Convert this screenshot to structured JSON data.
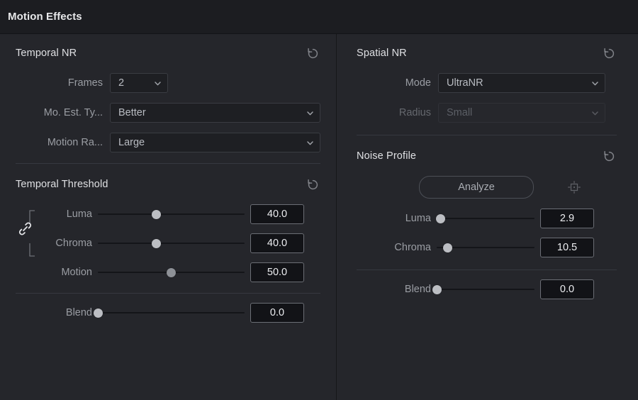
{
  "window": {
    "title": "Motion Effects"
  },
  "colors": {
    "background": "#25262b",
    "titlebar": "#1c1d21",
    "text_primary": "#dfe0e3",
    "text_label": "#9a9da3",
    "text_disabled": "#5c5f66",
    "value_text": "#ecedf0",
    "knob": "#bcbec3",
    "track": "#141519",
    "separator": "#363840"
  },
  "left_panel": {
    "temporal_nr": {
      "title": "Temporal NR",
      "reset_icon": "reset-icon",
      "fields": [
        {
          "label": "Frames",
          "value": "2",
          "type": "dropdown",
          "size": "small",
          "disabled": false
        },
        {
          "label": "Mo. Est. Ty...",
          "value": "Better",
          "type": "dropdown",
          "size": "large",
          "disabled": false
        },
        {
          "label": "Motion Ra...",
          "value": "Large",
          "type": "dropdown",
          "size": "large",
          "disabled": false
        }
      ]
    },
    "temporal_threshold": {
      "title": "Temporal Threshold",
      "reset_icon": "reset-icon",
      "link_icon": "link-icon",
      "sliders": [
        {
          "label": "Luma",
          "value": "40.0",
          "percent": 40,
          "muted": false,
          "linked": true
        },
        {
          "label": "Chroma",
          "value": "40.0",
          "percent": 40,
          "muted": false,
          "linked": true
        },
        {
          "label": "Motion",
          "value": "50.0",
          "percent": 50,
          "muted": true,
          "linked": false
        }
      ],
      "blend": {
        "label": "Blend",
        "value": "0.0",
        "percent": 0,
        "muted": false
      }
    }
  },
  "right_panel": {
    "spatial_nr": {
      "title": "Spatial NR",
      "reset_icon": "reset-icon",
      "fields": [
        {
          "label": "Mode",
          "value": "UltraNR",
          "type": "dropdown",
          "disabled": false
        },
        {
          "label": "Radius",
          "value": "Small",
          "type": "dropdown",
          "disabled": true
        }
      ]
    },
    "noise_profile": {
      "title": "Noise Profile",
      "reset_icon": "reset-icon",
      "analyze_label": "Analyze",
      "picker_icon": "target-picker-icon",
      "sliders": [
        {
          "label": "Luma",
          "value": "2.9",
          "percent": 4,
          "muted": false
        },
        {
          "label": "Chroma",
          "value": "10.5",
          "percent": 11,
          "muted": false
        }
      ],
      "blend": {
        "label": "Blend",
        "value": "0.0",
        "percent": 0,
        "muted": false
      }
    }
  }
}
